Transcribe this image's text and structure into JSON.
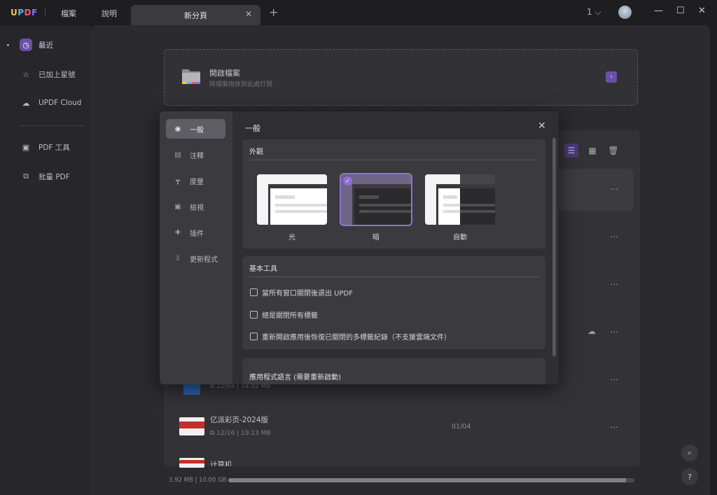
{
  "titlebar": {
    "logo": {
      "l1": "U",
      "l2": "P",
      "l3": "D",
      "l4": "F"
    },
    "menu": [
      "檔案",
      "說明"
    ],
    "tab_label": "新分頁",
    "tab_close": "✕",
    "tab_add": "+",
    "page_count": "1 ⌵",
    "window_buttons": {
      "minimize": "—",
      "maximize": "☐",
      "close": "✕"
    }
  },
  "sidebar": {
    "items": [
      {
        "label": "最近",
        "icon": "clock-icon"
      },
      {
        "label": "已加上星號",
        "icon": "star-icon"
      },
      {
        "label": "UPDF Cloud",
        "icon": "cloud-icon"
      },
      {
        "label": "PDF 工具",
        "icon": "toolbox-icon"
      },
      {
        "label": "批量 PDF",
        "icon": "batch-icon"
      }
    ]
  },
  "open_file": {
    "title": "開啟檔案",
    "subtitle": "將檔案拖放到此處打開",
    "button_icon": "arrow-right-icon"
  },
  "files": [
    {
      "name": "",
      "pages": "12/64",
      "size": "14.92 MB"
    },
    {
      "name": "亿派彩页-2024版",
      "pages": "12/16",
      "size": "19.13 MB",
      "opened_page": "01/04"
    },
    {
      "name": "计算机"
    }
  ],
  "storage": {
    "text": "3.92 MB | 10.00 GB",
    "fraction": 0.98
  },
  "help_buttons": {
    "search": "⌕",
    "help": "?"
  },
  "dialog": {
    "title": "一般",
    "close": "✕",
    "nav": [
      {
        "label": "一般",
        "icon": "general-icon"
      },
      {
        "label": "注釋",
        "icon": "comment-icon"
      },
      {
        "label": "度量",
        "icon": "ruler-icon"
      },
      {
        "label": "檢視",
        "icon": "view-icon"
      },
      {
        "label": "插件",
        "icon": "plugin-icon"
      },
      {
        "label": "更新程式",
        "icon": "update-icon"
      }
    ],
    "appearance": {
      "title": "外觀",
      "themes": [
        {
          "label": "光",
          "selected": false
        },
        {
          "label": "暗",
          "selected": true
        },
        {
          "label": "自動",
          "selected": false
        }
      ]
    },
    "basic_tools": {
      "title": "基本工具",
      "options": [
        {
          "label": "當所有窗口關閉後退出 UPDF",
          "checked": false
        },
        {
          "label": "總是關閉所有標籤",
          "checked": false
        },
        {
          "label": "重新開啟應用後恢復已關閉的多標籤紀錄（不支援雲端文件）",
          "checked": false
        }
      ]
    },
    "language": {
      "title": "應用程式語言 (需要重新啟動)"
    }
  },
  "colors": {
    "accent": "#8e72d8",
    "accent_dark": "#6b4fa8"
  }
}
